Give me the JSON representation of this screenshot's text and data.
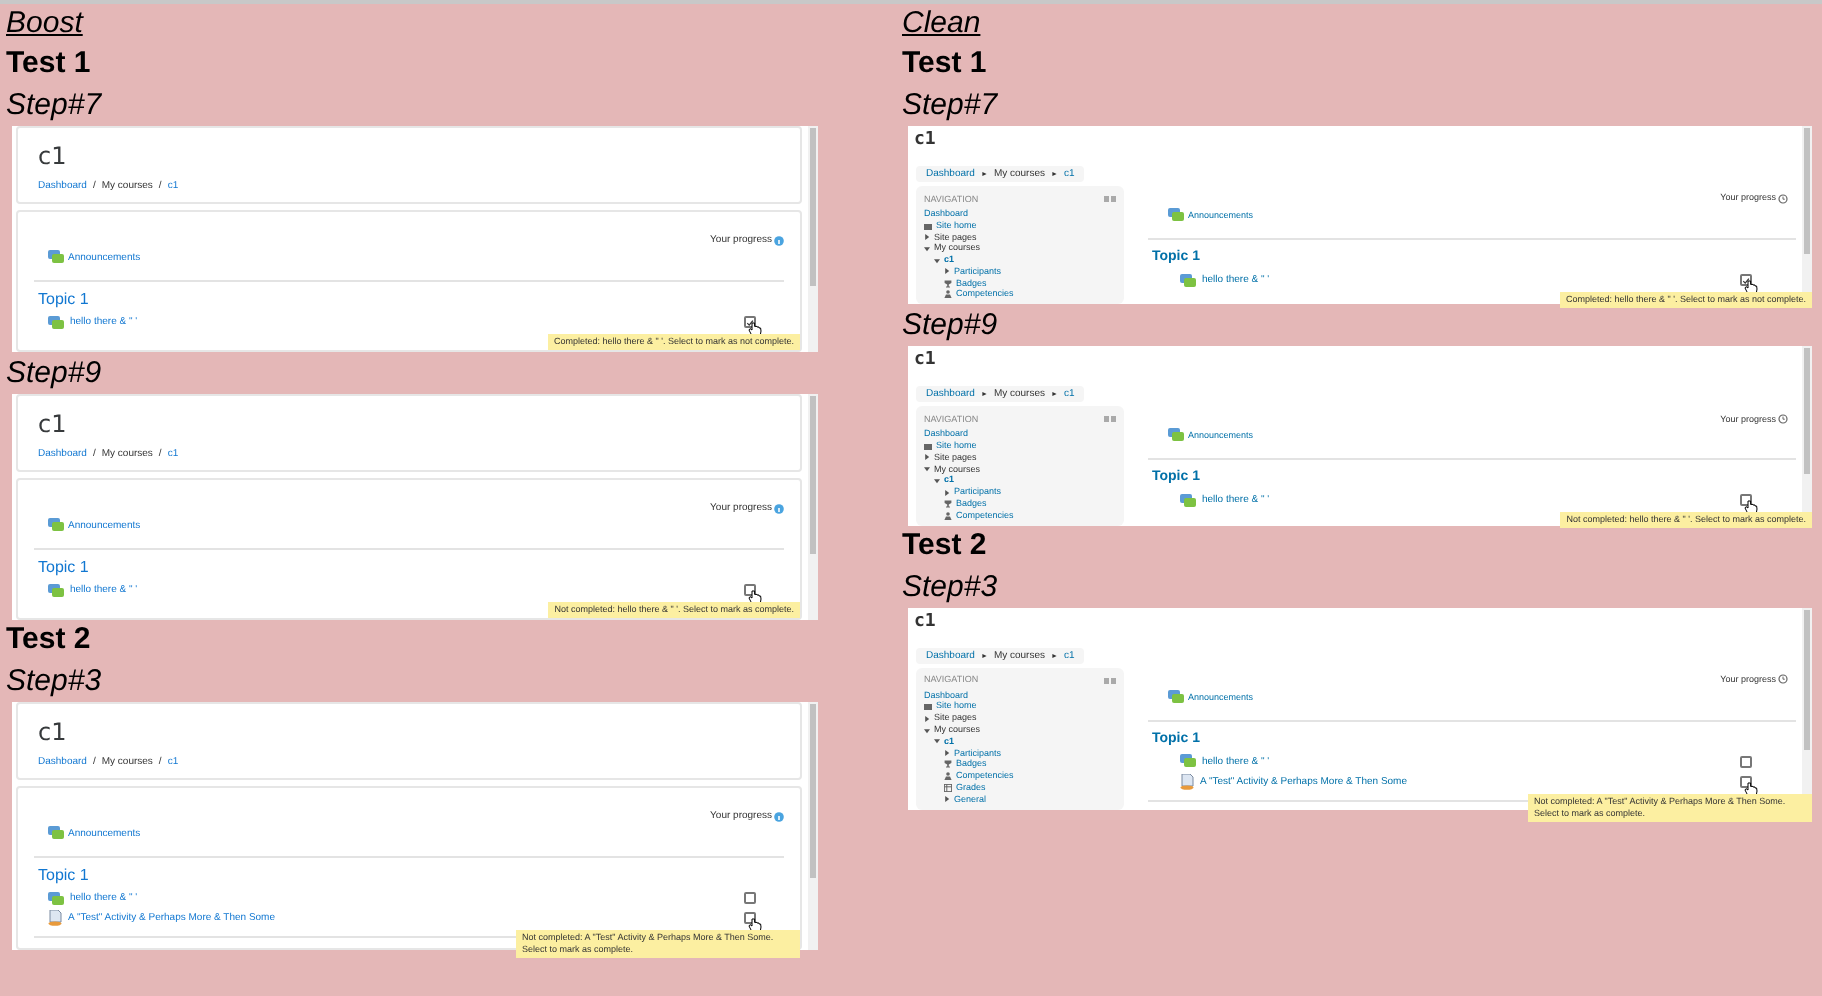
{
  "columns": [
    {
      "heading": "Boost",
      "tests": [
        {
          "title": "Test 1",
          "steps": [
            {
              "label": "Step#7",
              "screenshot": {
                "kind": "boost",
                "course_title": "c1",
                "breadcrumb_separator": "/",
                "breadcrumb": [
                  {
                    "label": "Dashboard",
                    "link": true
                  },
                  {
                    "label": "My courses",
                    "link": false
                  },
                  {
                    "label": "c1",
                    "link": true
                  }
                ],
                "progress_label": "Your progress",
                "announcements": "Announcements",
                "topic": "Topic 1",
                "activities": [
                  {
                    "name": "hello there & \" '",
                    "kind": "forum",
                    "checked": true,
                    "hovered": true
                  }
                ],
                "tooltip": "Completed: hello there & \" '. Select to mark as not complete."
              }
            },
            {
              "label": "Step#9",
              "screenshot": {
                "kind": "boost",
                "course_title": "c1",
                "breadcrumb_separator": "/",
                "breadcrumb": [
                  {
                    "label": "Dashboard",
                    "link": true
                  },
                  {
                    "label": "My courses",
                    "link": false
                  },
                  {
                    "label": "c1",
                    "link": true
                  }
                ],
                "progress_label": "Your progress",
                "announcements": "Announcements",
                "topic": "Topic 1",
                "activities": [
                  {
                    "name": "hello there & \" '",
                    "kind": "forum",
                    "checked": false,
                    "hovered": true
                  }
                ],
                "tooltip": "Not completed: hello there & \" '. Select to mark as complete."
              }
            }
          ]
        },
        {
          "title": "Test 2",
          "steps": [
            {
              "label": "Step#3",
              "screenshot": {
                "kind": "boost",
                "course_title": "c1",
                "breadcrumb_separator": "/",
                "breadcrumb": [
                  {
                    "label": "Dashboard",
                    "link": true
                  },
                  {
                    "label": "My courses",
                    "link": false
                  },
                  {
                    "label": "c1",
                    "link": true
                  }
                ],
                "progress_label": "Your progress",
                "announcements": "Announcements",
                "topic": "Topic 1",
                "activities": [
                  {
                    "name": "hello there & \" '",
                    "kind": "forum",
                    "checked": false,
                    "hovered": false
                  },
                  {
                    "name": "A \"Test\" Activity & Perhaps More & Then Some",
                    "kind": "page",
                    "checked": false,
                    "hovered": true
                  }
                ],
                "tooltip": "Not completed: A \"Test\" Activity & Perhaps More & Then Some. Select to mark as complete."
              }
            }
          ]
        }
      ]
    },
    {
      "heading": "Clean",
      "tests": [
        {
          "title": "Test 1",
          "steps": [
            {
              "label": "Step#7",
              "screenshot": {
                "kind": "clean",
                "course_title": "c1",
                "breadcrumb_separator": "►",
                "breadcrumb": [
                  {
                    "label": "Dashboard",
                    "link": true
                  },
                  {
                    "label": "My courses",
                    "link": false
                  },
                  {
                    "label": "c1",
                    "link": true
                  }
                ],
                "navigation": {
                  "title": "NAVIGATION",
                  "items": [
                    {
                      "label": "Dashboard",
                      "kind": "text"
                    },
                    {
                      "label": "Site home",
                      "kind": "home"
                    },
                    {
                      "label": "Site pages",
                      "kind": "branch",
                      "expanded": false
                    },
                    {
                      "label": "My courses",
                      "kind": "branch",
                      "expanded": true,
                      "children": [
                        {
                          "label": "c1",
                          "kind": "branch",
                          "expanded": true,
                          "children": [
                            {
                              "label": "Participants",
                              "kind": "branch",
                              "expanded": false
                            },
                            {
                              "label": "Badges",
                              "kind": "trophy"
                            },
                            {
                              "label": "Competencies",
                              "kind": "people"
                            }
                          ]
                        }
                      ]
                    }
                  ]
                },
                "progress_label": "Your progress",
                "announcements": "Announcements",
                "topic": "Topic 1",
                "activities": [
                  {
                    "name": "hello there & \" '",
                    "kind": "forum",
                    "checked": true,
                    "hovered": true
                  }
                ],
                "tooltip": "Completed: hello there & \" '. Select to mark as not complete."
              }
            },
            {
              "label": "Step#9",
              "screenshot": {
                "kind": "clean",
                "course_title": "c1",
                "breadcrumb_separator": "►",
                "breadcrumb": [
                  {
                    "label": "Dashboard",
                    "link": true
                  },
                  {
                    "label": "My courses",
                    "link": false
                  },
                  {
                    "label": "c1",
                    "link": true
                  }
                ],
                "navigation": {
                  "title": "NAVIGATION",
                  "items": [
                    {
                      "label": "Dashboard",
                      "kind": "text"
                    },
                    {
                      "label": "Site home",
                      "kind": "home"
                    },
                    {
                      "label": "Site pages",
                      "kind": "branch",
                      "expanded": false
                    },
                    {
                      "label": "My courses",
                      "kind": "branch",
                      "expanded": true,
                      "children": [
                        {
                          "label": "c1",
                          "kind": "branch",
                          "expanded": true,
                          "children": [
                            {
                              "label": "Participants",
                              "kind": "branch",
                              "expanded": false
                            },
                            {
                              "label": "Badges",
                              "kind": "trophy"
                            },
                            {
                              "label": "Competencies",
                              "kind": "people"
                            }
                          ]
                        }
                      ]
                    }
                  ]
                },
                "progress_label": "Your progress",
                "announcements": "Announcements",
                "topic": "Topic 1",
                "activities": [
                  {
                    "name": "hello there & \" '",
                    "kind": "forum",
                    "checked": false,
                    "hovered": true
                  }
                ],
                "tooltip": "Not completed: hello there & \" '. Select to mark as complete."
              }
            }
          ]
        },
        {
          "title": "Test 2",
          "steps": [
            {
              "label": "Step#3",
              "screenshot": {
                "kind": "clean",
                "course_title": "c1",
                "breadcrumb_separator": "►",
                "breadcrumb": [
                  {
                    "label": "Dashboard",
                    "link": true
                  },
                  {
                    "label": "My courses",
                    "link": false
                  },
                  {
                    "label": "c1",
                    "link": true
                  }
                ],
                "navigation": {
                  "title": "NAVIGATION",
                  "items": [
                    {
                      "label": "Dashboard",
                      "kind": "text"
                    },
                    {
                      "label": "Site home",
                      "kind": "home"
                    },
                    {
                      "label": "Site pages",
                      "kind": "branch",
                      "expanded": false
                    },
                    {
                      "label": "My courses",
                      "kind": "branch",
                      "expanded": true,
                      "children": [
                        {
                          "label": "c1",
                          "kind": "branch",
                          "expanded": true,
                          "children": [
                            {
                              "label": "Participants",
                              "kind": "branch",
                              "expanded": false
                            },
                            {
                              "label": "Badges",
                              "kind": "trophy"
                            },
                            {
                              "label": "Competencies",
                              "kind": "people"
                            },
                            {
                              "label": "Grades",
                              "kind": "table"
                            },
                            {
                              "label": "General",
                              "kind": "branch",
                              "expanded": false
                            }
                          ]
                        }
                      ]
                    }
                  ]
                },
                "progress_label": "Your progress",
                "announcements": "Announcements",
                "topic": "Topic 1",
                "activities": [
                  {
                    "name": "hello there & \" '",
                    "kind": "forum",
                    "checked": false,
                    "hovered": false
                  },
                  {
                    "name": "A \"Test\" Activity & Perhaps More & Then Some",
                    "kind": "page",
                    "checked": false,
                    "hovered": true
                  }
                ],
                "tooltip": "Not completed: A \"Test\" Activity & Perhaps More & Then Some. Select to mark as complete."
              }
            }
          ]
        }
      ]
    }
  ]
}
